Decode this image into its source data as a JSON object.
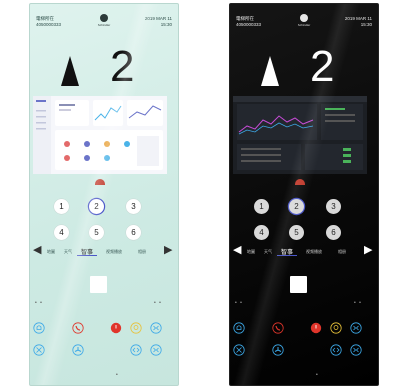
{
  "panels": [
    {
      "theme": "light",
      "header_left_line1": "電梯所在",
      "header_left_line2": "4050000333",
      "header_right_line1": "2019 MAR 11",
      "header_right_line2": "15:30",
      "logo_text": "Schindler",
      "floor": "2",
      "keys": [
        "1",
        "2",
        "3",
        "4",
        "5",
        "6"
      ],
      "tabs": [
        "地圖",
        "天气",
        "智事",
        "视频播放",
        "相册"
      ],
      "active_tab": "智事"
    },
    {
      "theme": "dark",
      "header_left_line1": "電梯所在",
      "header_left_line2": "4050000333",
      "header_right_line1": "2019 MAR 11",
      "header_right_line2": "15:30",
      "logo_text": "Schindler",
      "floor": "2",
      "keys": [
        "1",
        "2",
        "3",
        "4",
        "5",
        "6"
      ],
      "tabs": [
        "地圖",
        "天气",
        "智事",
        "视频播放",
        "相册"
      ],
      "active_tab": "智事"
    }
  ],
  "colors": {
    "accent": "#4a56c8",
    "alarm_red": "#e0352b",
    "icon_blue": "#3da9e8",
    "icon_yellow": "#e8c23a"
  },
  "icons": [
    "bell-icon",
    "phone-icon",
    "power-icon",
    "bulb-icon",
    "door-close-icon",
    "fan-off-icon",
    "fan-icon",
    "door-open-icon",
    "door-close-icon-2"
  ]
}
